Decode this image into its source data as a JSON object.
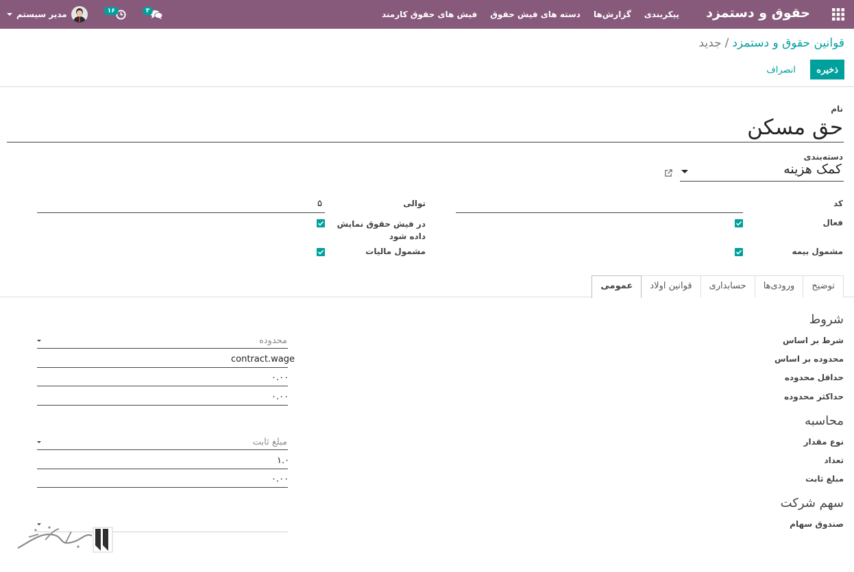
{
  "navbar": {
    "brand": "حقوق و دستمزد",
    "menu": [
      "فیش های حقوق کارمند",
      "دسته های فیش حقوق",
      "گزارش‌ها",
      "پیکربندی"
    ],
    "user_name": "مدیر سیستم",
    "messages_count": "۳",
    "activities_count": "۱۶",
    "apps_icon": "grid-icon",
    "accent": "#875a7b"
  },
  "control_panel": {
    "breadcrumb_parent": "قوانین حقوق و دستمزد",
    "breadcrumb_separator": "/",
    "breadcrumb_current": "جدید",
    "save_label": "ذخیره",
    "discard_label": "انصراف",
    "primary_color": "#00a09d"
  },
  "form": {
    "name_label": "نام",
    "name_value": "حق مسکن",
    "category_label": "دسته‌بندی",
    "category_value": "کمک هزینه",
    "code_label": "کد",
    "code_value": "",
    "sequence_label": "توالی",
    "sequence_value": "۵",
    "active_label": "فعال",
    "active_checked": true,
    "show_on_payslip_label": "در فیش حقوق نمایش داده شود",
    "show_on_payslip_checked": true,
    "insurance_label": "مشمول بیمه",
    "insurance_checked": true,
    "tax_label": "مشمول مالیات",
    "tax_checked": true
  },
  "tabs": [
    "عمومی",
    "قوانین اولاد",
    "حسابداری",
    "ورودی‌ها",
    "توضیح"
  ],
  "active_tab": "عمومی",
  "general": {
    "conditions_title": "شروط",
    "condition_based_on_label": "شرط بر اساس",
    "condition_based_on_value": "محدوده",
    "range_based_on_label": "محدوده بر اساس",
    "range_based_on_value": "contract.wage",
    "min_range_label": "حداقل محدوده",
    "min_range_value": "۰.۰۰",
    "max_range_label": "حداکثر محدوده",
    "max_range_value": "۰.۰۰",
    "computation_title": "محاسبه",
    "amount_type_label": "نوع مقدار",
    "amount_type_value": "مبلغ ثابت",
    "quantity_label": "تعداد",
    "quantity_value": "۱.۰",
    "fixed_amount_label": "مبلغ ثابت",
    "fixed_amount_value": "۰.۰۰",
    "company_contribution_title": "سهم شرکت",
    "contribution_register_label": "صندوق سهام",
    "contribution_register_value": ""
  }
}
